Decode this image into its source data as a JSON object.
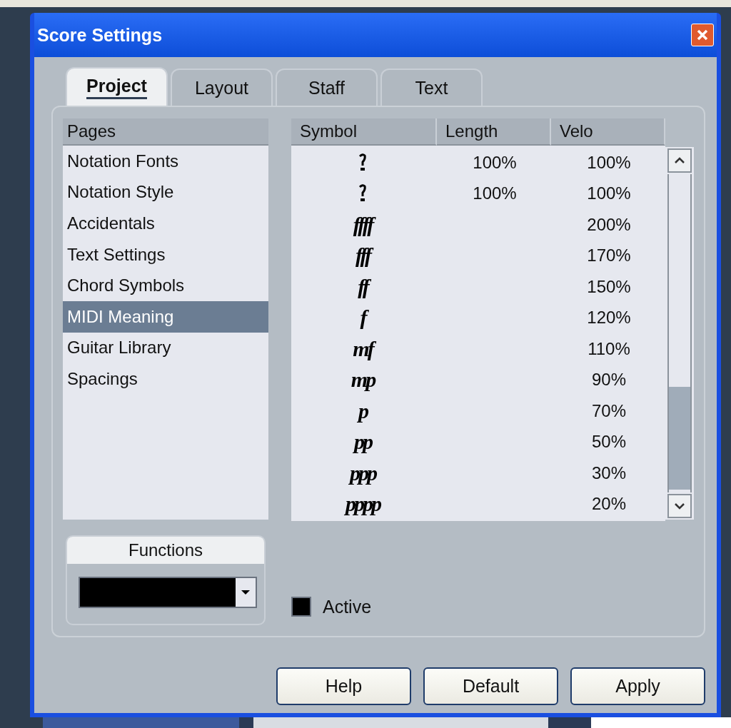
{
  "window": {
    "title": "Score Settings"
  },
  "tabs": [
    {
      "label": "Project",
      "selected": true
    },
    {
      "label": "Layout",
      "selected": false
    },
    {
      "label": "Staff",
      "selected": false
    },
    {
      "label": "Text",
      "selected": false
    }
  ],
  "pages": {
    "header": "Pages",
    "items": [
      {
        "label": "Notation Fonts",
        "selected": false
      },
      {
        "label": "Notation Style",
        "selected": false
      },
      {
        "label": "Accidentals",
        "selected": false
      },
      {
        "label": "Text Settings",
        "selected": false
      },
      {
        "label": "Chord Symbols",
        "selected": false
      },
      {
        "label": "MIDI Meaning",
        "selected": true
      },
      {
        "label": "Guitar Library",
        "selected": false
      },
      {
        "label": "Spacings",
        "selected": false
      }
    ]
  },
  "table": {
    "columns": [
      "Symbol",
      "Length",
      "Velo"
    ],
    "rows": [
      {
        "kind": "glyph",
        "length": "100%",
        "velo": "100%"
      },
      {
        "kind": "glyph",
        "length": "100%",
        "velo": "100%"
      },
      {
        "kind": "dynamic",
        "symbol": "ffff",
        "velo": "200%"
      },
      {
        "kind": "dynamic",
        "symbol": "fff",
        "velo": "170%"
      },
      {
        "kind": "dynamic",
        "symbol": "ff",
        "velo": "150%"
      },
      {
        "kind": "dynamic",
        "symbol": "f",
        "velo": "120%"
      },
      {
        "kind": "dynamic",
        "symbol": "mf",
        "velo": "110%"
      },
      {
        "kind": "dynamic",
        "symbol": "mp",
        "velo": "90%"
      },
      {
        "kind": "dynamic",
        "symbol": "p",
        "velo": "70%"
      },
      {
        "kind": "dynamic",
        "symbol": "pp",
        "velo": "50%"
      },
      {
        "kind": "dynamic",
        "symbol": "ppp",
        "velo": "30%"
      },
      {
        "kind": "dynamic",
        "symbol": "pppp",
        "velo": "20%"
      }
    ]
  },
  "functions": {
    "title": "Functions"
  },
  "active": {
    "label": "Active",
    "checked": true
  },
  "buttons": [
    "Help",
    "Default",
    "Apply"
  ]
}
